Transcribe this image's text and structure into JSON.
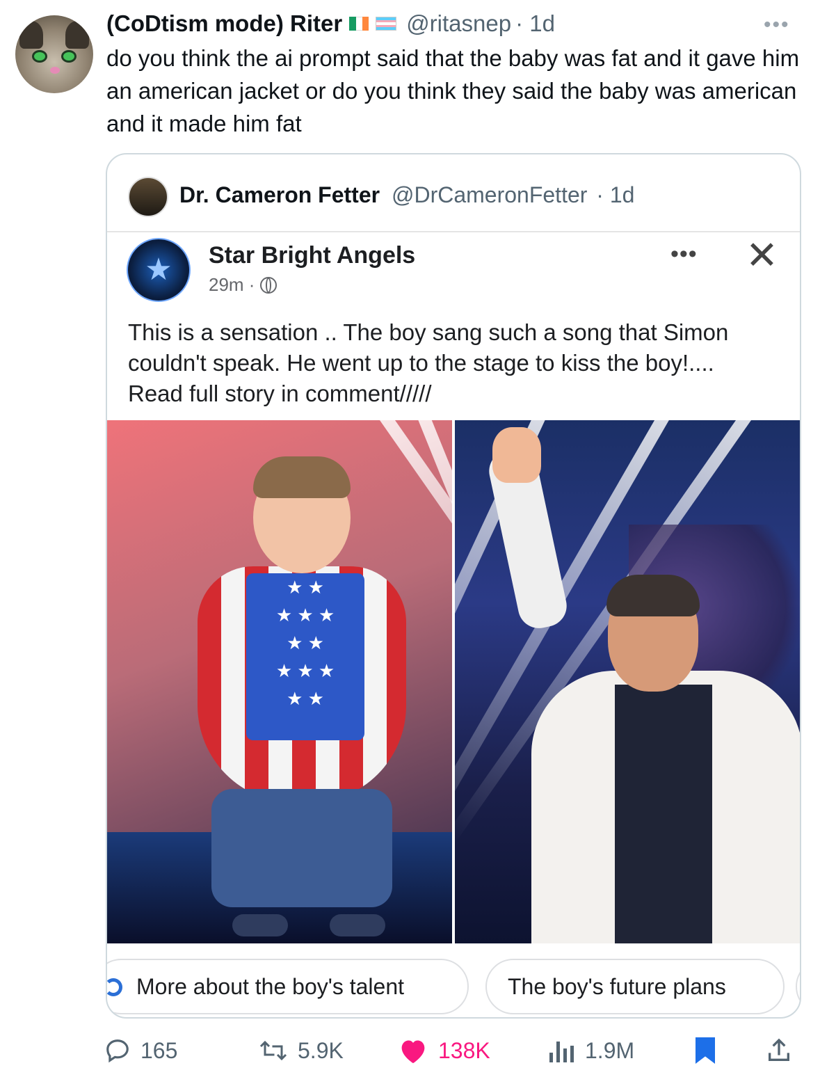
{
  "tweet": {
    "author_name": "(CoDtism mode) Riter",
    "author_handle": "@ritasnep",
    "time": "· 1d",
    "more": "•••",
    "text": "do you think the ai prompt said that the baby was fat and it gave him an american jacket or do you think they said the baby was american and it made him fat"
  },
  "quote": {
    "author_name": "Dr. Cameron Fetter",
    "author_handle": "@DrCameronFetter",
    "time": "· 1d",
    "fb_post": {
      "page_name": "Star Bright Angels",
      "logo_glyph": "★",
      "time": "29m ·",
      "more": "•••",
      "close": "✕",
      "text": "This is a sensation .. The boy sang such a song that Simon couldn't speak. He went up to the stage to kiss the boy!.... Read full story in comment/////",
      "chips": [
        "More about the boy's talent",
        "The boy's future plans"
      ]
    }
  },
  "actions": {
    "replies": "165",
    "retweets": "5.9K",
    "likes": "138K",
    "views": "1.9M"
  },
  "icons": {
    "reply": "reply-icon",
    "retweet": "retweet-icon",
    "like": "heart-icon",
    "views": "views-icon",
    "bookmark": "bookmark-icon",
    "share": "share-icon"
  },
  "colors": {
    "like": "#f91880",
    "bookmark": "#1d6fe8",
    "secondary_text": "#536471"
  }
}
